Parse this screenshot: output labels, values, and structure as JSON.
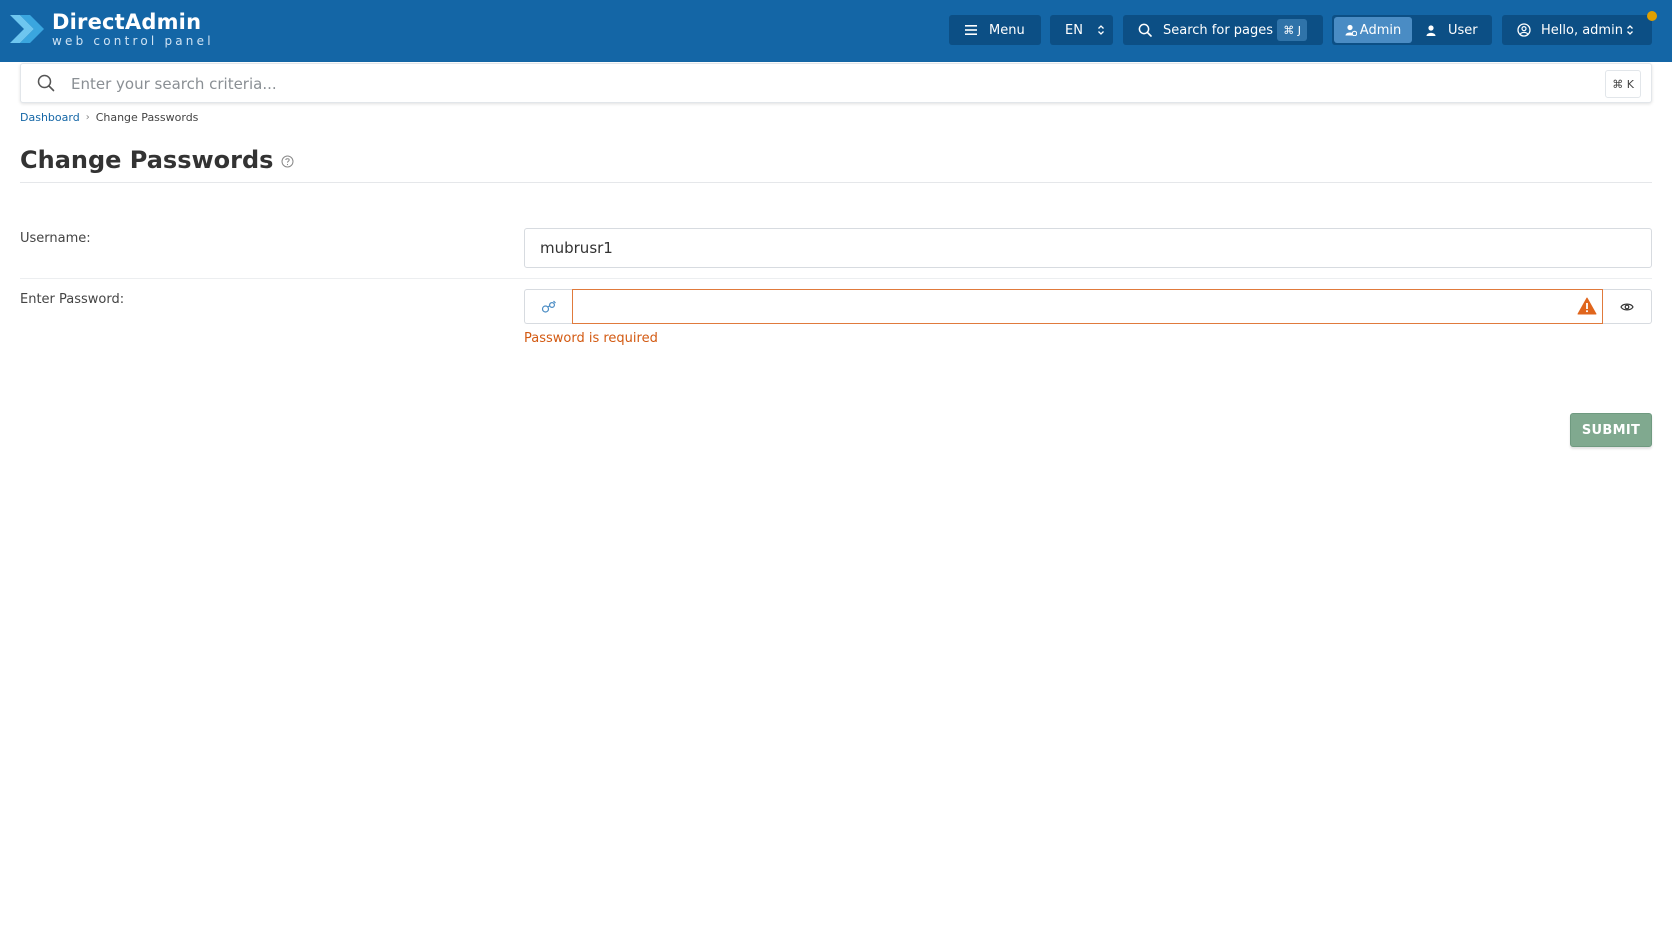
{
  "brand": {
    "title": "DirectAdmin",
    "subtitle": "web control panel"
  },
  "topbar": {
    "menu_label": "Menu",
    "language": "EN",
    "search_label": "Search for pages",
    "search_shortcut": "⌘ J",
    "role_admin": "Admin",
    "role_user": "User",
    "greeting": "Hello, admin"
  },
  "search": {
    "placeholder": "Enter your search criteria...",
    "shortcut": "⌘ K"
  },
  "breadcrumb": {
    "home": "Dashboard",
    "current": "Change Passwords"
  },
  "page": {
    "title": "Change Passwords"
  },
  "form": {
    "username_label": "Username:",
    "username_value": "mubrusr1",
    "password_label": "Enter Password:",
    "password_value": "",
    "password_error": "Password is required",
    "submit_label": "SUBMIT"
  },
  "colors": {
    "topbar": "#1466a6",
    "topbar_button": "#0c4f85",
    "error": "#d35a12",
    "submit": "#80a98f",
    "notification": "#e0a000"
  },
  "icons": [
    "directadmin-logo-icon",
    "hamburger-icon",
    "updown-icon",
    "search-icon",
    "admin-user-icon",
    "user-icon",
    "user-circle-icon",
    "help-icon",
    "chevron-right-icon",
    "generate-password-icon",
    "warning-icon",
    "eye-icon"
  ]
}
